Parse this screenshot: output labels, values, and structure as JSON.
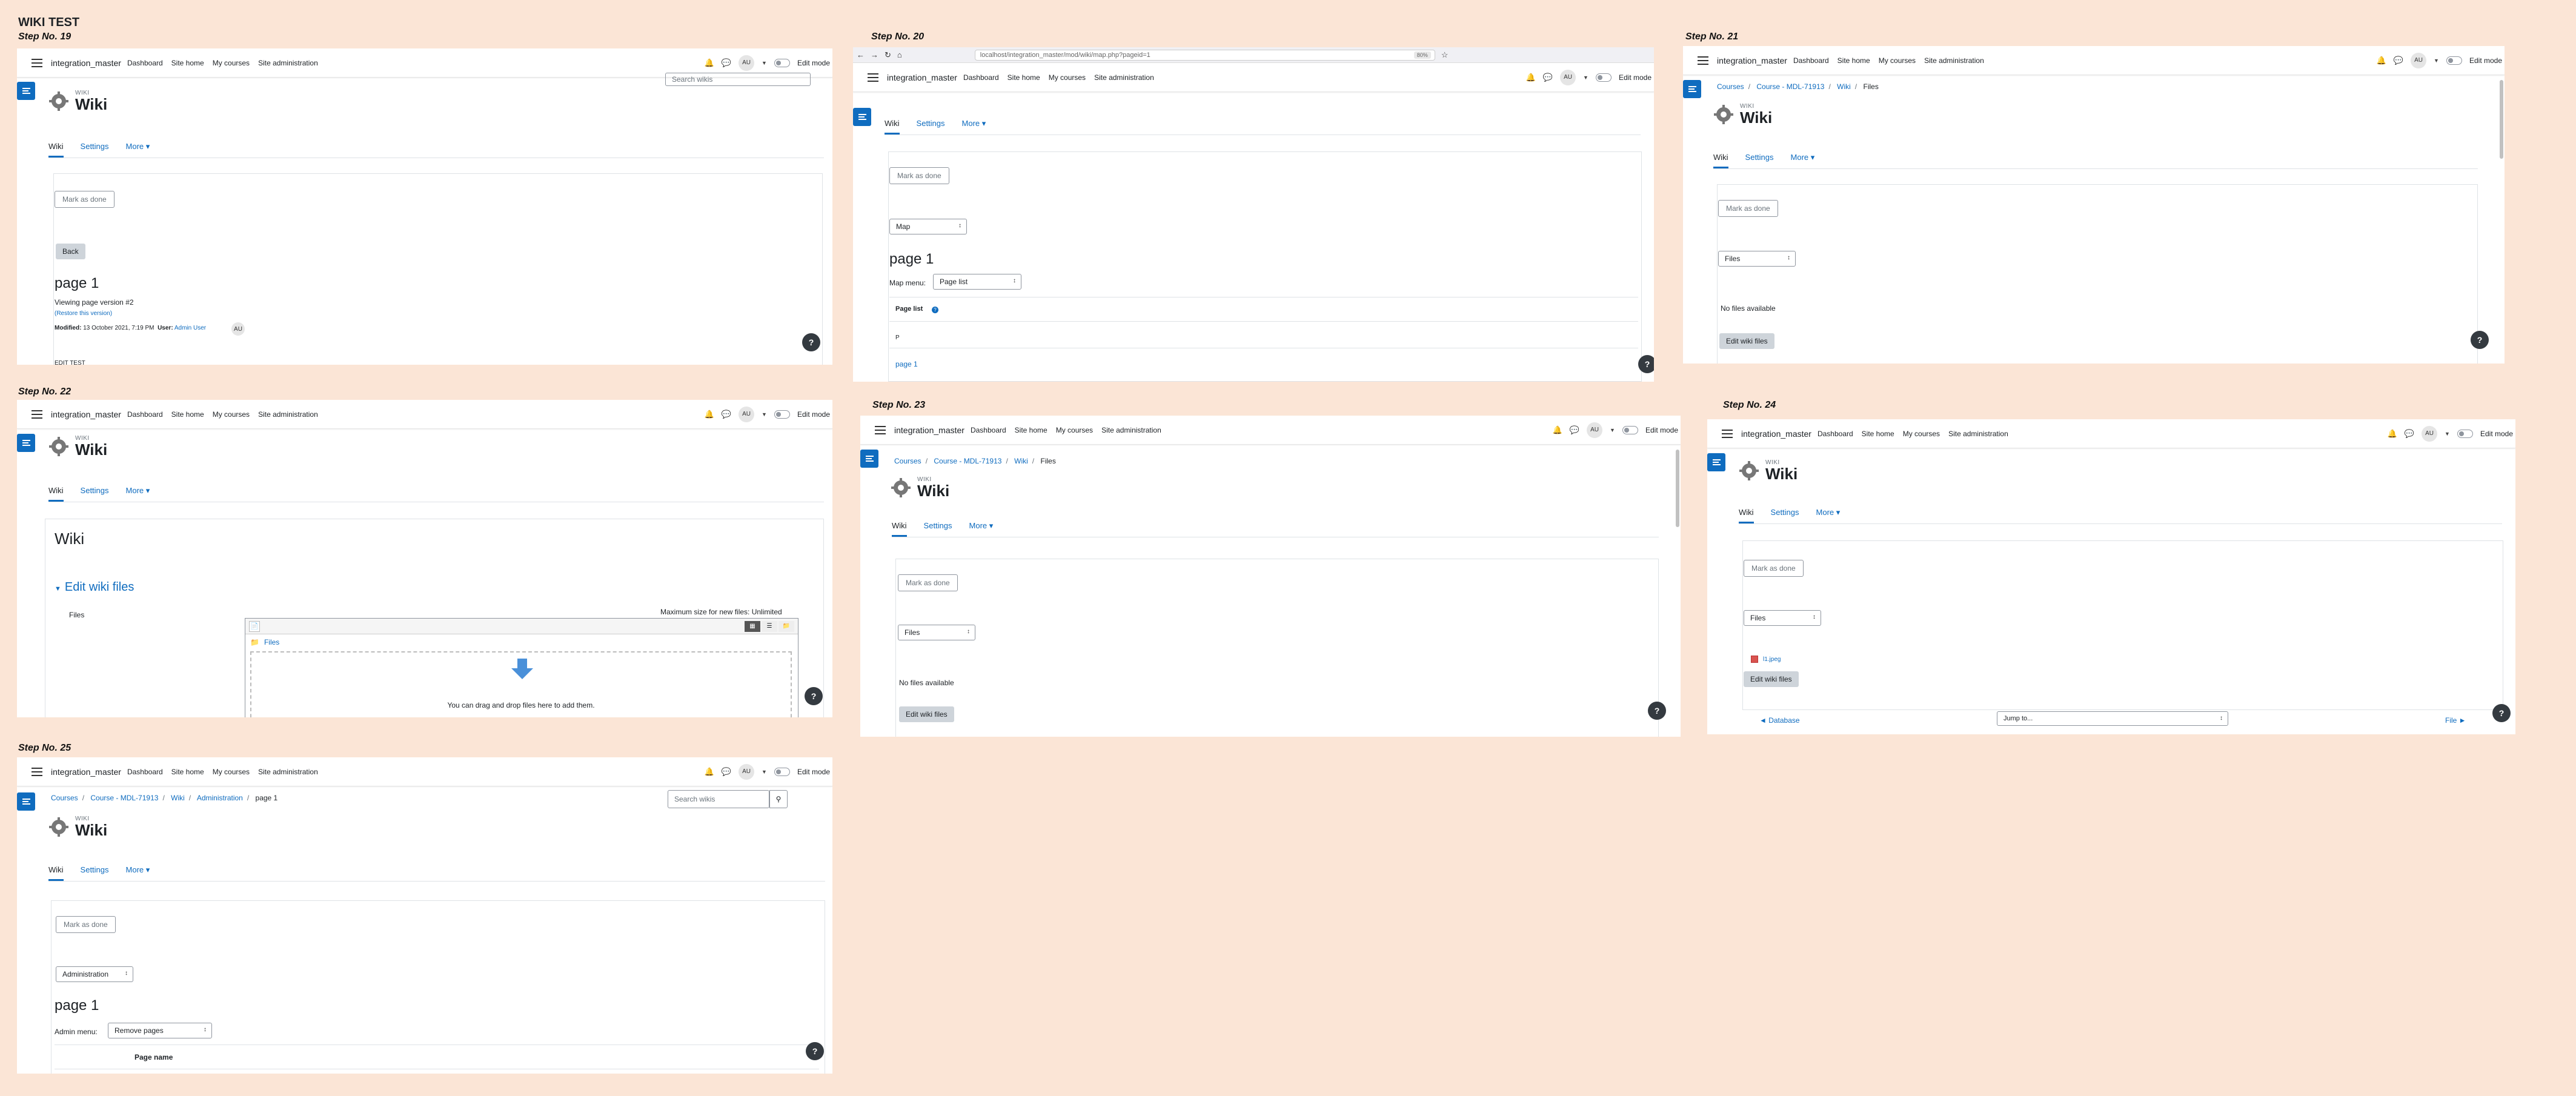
{
  "board_title": "WIKI TEST",
  "steps": {
    "s19": "Step No. 19",
    "s20": "Step No. 20",
    "s21": "Step No. 21",
    "s22": "Step No. 22",
    "s23": "Step No. 23",
    "s24": "Step No. 24",
    "s25": "Step No. 25"
  },
  "nav": {
    "brand": "integration_master",
    "dashboard": "Dashboard",
    "site_home": "Site home",
    "my_courses": "My courses",
    "site_admin": "Site administration",
    "avatar": "AU",
    "edit_mode": "Edit mode"
  },
  "browser": {
    "url": "localhost/integration_master/mod/wiki/map.php?pageid=1",
    "zoom": "80%"
  },
  "crumbs": {
    "courses": "Courses",
    "course": "Course - MDL-71913",
    "wiki": "Wiki",
    "files": "Files",
    "administration": "Administration",
    "page1": "page 1"
  },
  "wiki": {
    "small": "WIKI",
    "title": "Wiki"
  },
  "tabs": {
    "wiki": "Wiki",
    "settings": "Settings",
    "more": "More ▾"
  },
  "common": {
    "mark_done": "Mark as done",
    "help": "?",
    "search_wikis": "Search wikis",
    "search_icon": "🔍"
  },
  "s19": {
    "back": "Back",
    "page_title": "page 1",
    "viewing": "Viewing page version #2",
    "restore": "(Restore this version)",
    "modified_label": "Modified:",
    "modified_value": "13 October 2021, 7:19 PM",
    "user_label": "User:",
    "user_value": "Admin User",
    "edit_test": "EDIT TEST"
  },
  "s20": {
    "select_value": "Map",
    "page_title": "page 1",
    "map_menu_label": "Map menu:",
    "map_menu_value": "Page list",
    "page_list_heading": "Page list",
    "letter": "P",
    "page_link": "page 1"
  },
  "s21": {
    "select_value": "Files",
    "no_files": "No files available",
    "edit_files": "Edit wiki files"
  },
  "s22": {
    "heading": "Wiki",
    "section": "Edit wiki files",
    "files_label": "Files",
    "max_size": "Maximum size for new files: Unlimited",
    "files_folder": "Files",
    "drop_text": "You can drag and drop files here to add them."
  },
  "s23": {
    "select_value": "Files",
    "no_files": "No files available",
    "edit_files": "Edit wiki files"
  },
  "s24": {
    "select_value": "Files",
    "file_name": "l1.jpeg",
    "edit_files": "Edit wiki files",
    "prev_link": "◄ Database",
    "jump_to": "Jump to...",
    "next_link": "File ►"
  },
  "s25": {
    "select_value": "Administration",
    "page_title": "page 1",
    "admin_menu_label": "Admin menu:",
    "admin_menu_value": "Remove pages",
    "page_name_header": "Page name"
  }
}
